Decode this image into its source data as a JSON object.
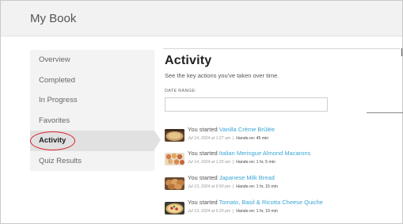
{
  "app": {
    "title": "My Book"
  },
  "sidebar": {
    "items": [
      {
        "label": "Overview"
      },
      {
        "label": "Completed"
      },
      {
        "label": "In Progress"
      },
      {
        "label": "Favorites"
      },
      {
        "label": "Activity",
        "active": true
      },
      {
        "label": "Quiz Results"
      }
    ]
  },
  "main": {
    "title": "Activity",
    "subtitle": "See the key actions you've taken over time.",
    "date_range_label": "DATE RANGE:",
    "date_range_value": "",
    "activities": [
      {
        "prefix": "You started ",
        "recipe": "Vanilla Crème Brûlée",
        "date": "Jul 14, 2024 at 1:27 am",
        "hands_on": "Hands-on: 45 min",
        "thumb": "creme-brulee-thumbnail"
      },
      {
        "prefix": "You started ",
        "recipe": "Italian Meringue Almond Macarons",
        "date": "Jul 14, 2024 at 1:20 am",
        "hands_on": "Hands-on: 1 hr, 5 min",
        "thumb": "macarons-thumbnail"
      },
      {
        "prefix": "You started ",
        "recipe": "Japanese Milk Bread",
        "date": "Jul 13, 2024 at 6:50 pm",
        "hands_on": "Hands-on: 1 hr, 15 min",
        "thumb": "milk-bread-thumbnail"
      },
      {
        "prefix": "You started ",
        "recipe": "Tomato, Basil & Ricotta Cheese Quiche",
        "date": "Jul 13, 2024 at 6:29 pm",
        "hands_on": "Hands-on: 1 hr, 10 min",
        "thumb": "quiche-thumbnail"
      }
    ]
  },
  "colors": {
    "link": "#3aa6d6",
    "highlight_circle": "#d8232a",
    "sidebar_bg": "#f3f3f3",
    "active_bg": "#e1e1e1"
  }
}
